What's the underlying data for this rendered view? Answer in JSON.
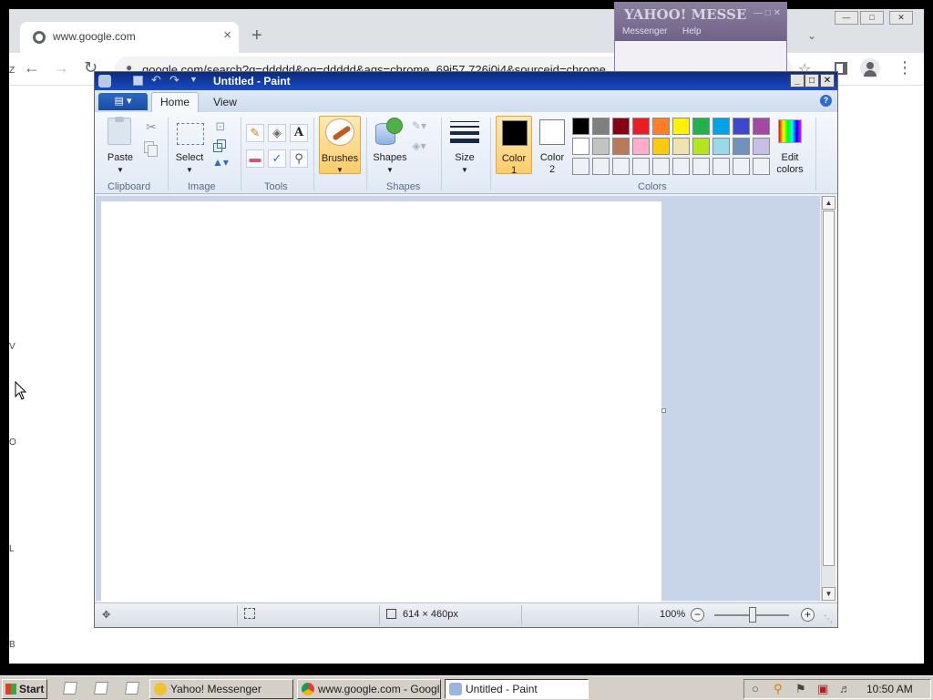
{
  "browser": {
    "tab_title": "www.google.com",
    "tab_close": "×",
    "new_tab": "+",
    "address": "google.com/search?q=ddddd&oq=ddddd&aqs=chrome..69i57.726j0j4&sourceid=chrome",
    "page_fragments": [
      "Z",
      "V",
      "O",
      "L",
      "B"
    ]
  },
  "yahoo": {
    "logo": "YAHOO! MESSE",
    "menu": [
      "Messenger",
      "Help"
    ]
  },
  "paint": {
    "title": "Untitled - Paint",
    "tabs": [
      "Home",
      "View"
    ],
    "groups": {
      "clipboard": "Clipboard",
      "image": "Image",
      "tools": "Tools",
      "shapes": "Shapes",
      "colors": "Colors"
    },
    "buttons": {
      "paste": "Paste",
      "select": "Select",
      "brushes": "Brushes",
      "shapes": "Shapes",
      "size": "Size",
      "color1_line1": "Color",
      "color1_line2": "1",
      "color2_line1": "Color",
      "color2_line2": "2",
      "edit_colors_line1": "Edit",
      "edit_colors_line2": "colors"
    },
    "color1": "#000000",
    "color2": "#ffffff",
    "palette": [
      [
        "#000000",
        "#7f7f7f",
        "#880015",
        "#ed1c24",
        "#ff7f27",
        "#fff200",
        "#22b14c",
        "#00a2e8",
        "#3f48cc",
        "#a349a4"
      ],
      [
        "#ffffff",
        "#c3c3c3",
        "#b97a57",
        "#ffaec9",
        "#ffc90e",
        "#efe4b0",
        "#b5e61d",
        "#99d9ea",
        "#7092be",
        "#c8bfe7"
      ],
      [
        "#eef1f5",
        "#eef1f5",
        "#eef1f5",
        "#eef1f5",
        "#eef1f5",
        "#eef1f5",
        "#eef1f5",
        "#eef1f5",
        "#eef1f5",
        "#eef1f5"
      ]
    ],
    "status": {
      "canvas_size": "614 × 460px",
      "zoom": "100%"
    }
  },
  "taskbar": {
    "start": "Start",
    "tasks": [
      {
        "label": "Yahoo! Messenger"
      },
      {
        "label": "www.google.com - Googl..."
      },
      {
        "label": "Untitled - Paint"
      }
    ],
    "clock": "10:50 AM"
  }
}
